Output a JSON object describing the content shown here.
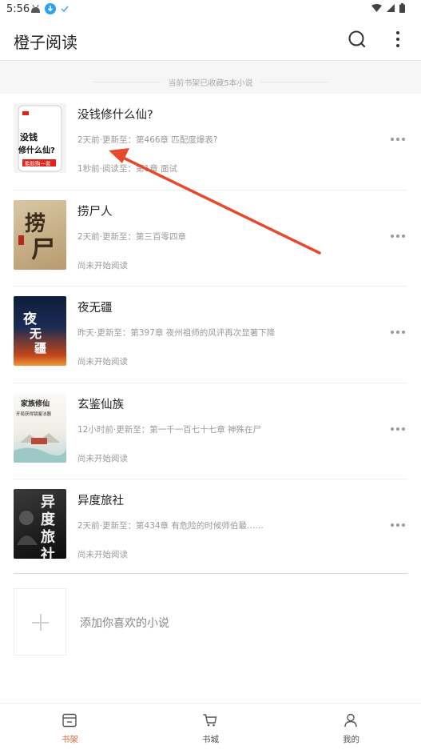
{
  "status_bar": {
    "time": "5:56"
  },
  "app_bar": {
    "title": "橙子阅读"
  },
  "shelf_notice": "当前书架已收藏5本小说",
  "books": [
    {
      "title": "没钱修什么仙?",
      "update": "2天前·更新至：第466章 匹配度爆表?",
      "read": "1秒前·阅读至：第1章 面试",
      "cover": {
        "style": "phone",
        "lines": [
          "没钱",
          "修什么仙?",
          "能赊购一套"
        ],
        "accent": "#e0241c"
      }
    },
    {
      "title": "捞尸人",
      "update": "2天前·更新至：第三百零四章",
      "read": "尚未开始阅读",
      "cover": {
        "style": "calligraphy",
        "lines": [
          "捞",
          "尸"
        ],
        "accent": "#3a2a1a"
      }
    },
    {
      "title": "夜无疆",
      "update": "昨天·更新至：第397章 夜州祖师的风评再次显著下降",
      "read": "尚未开始阅读",
      "cover": {
        "style": "fire",
        "lines": [
          "夜",
          "无",
          "疆"
        ],
        "accent": "#e8632a"
      }
    },
    {
      "title": "玄鉴仙族",
      "update": "12小时前·更新至：第一千一百七十七章 神殊在尸",
      "read": "尚未开始阅读",
      "cover": {
        "style": "ink",
        "lines": [
          "家族修仙",
          "开局获得镜鉴法器"
        ],
        "accent": "#2a2a2a"
      }
    },
    {
      "title": "异度旅社",
      "update": "2天前·更新至：第434章 有危险的时候师伯最……",
      "read": "尚未开始阅读",
      "cover": {
        "style": "dark",
        "lines": [
          "异",
          "度",
          "旅",
          "社"
        ],
        "accent": "#f2f2f2"
      }
    }
  ],
  "add_label": "添加你喜欢的小说",
  "bottom_nav": [
    {
      "label": "书架",
      "icon": "bookshelf-icon",
      "active": true
    },
    {
      "label": "书城",
      "icon": "cart-icon",
      "active": false
    },
    {
      "label": "我的",
      "icon": "person-icon",
      "active": false
    }
  ],
  "colors": {
    "accent": "#f06a3c",
    "annotation": "#e64a2e"
  }
}
